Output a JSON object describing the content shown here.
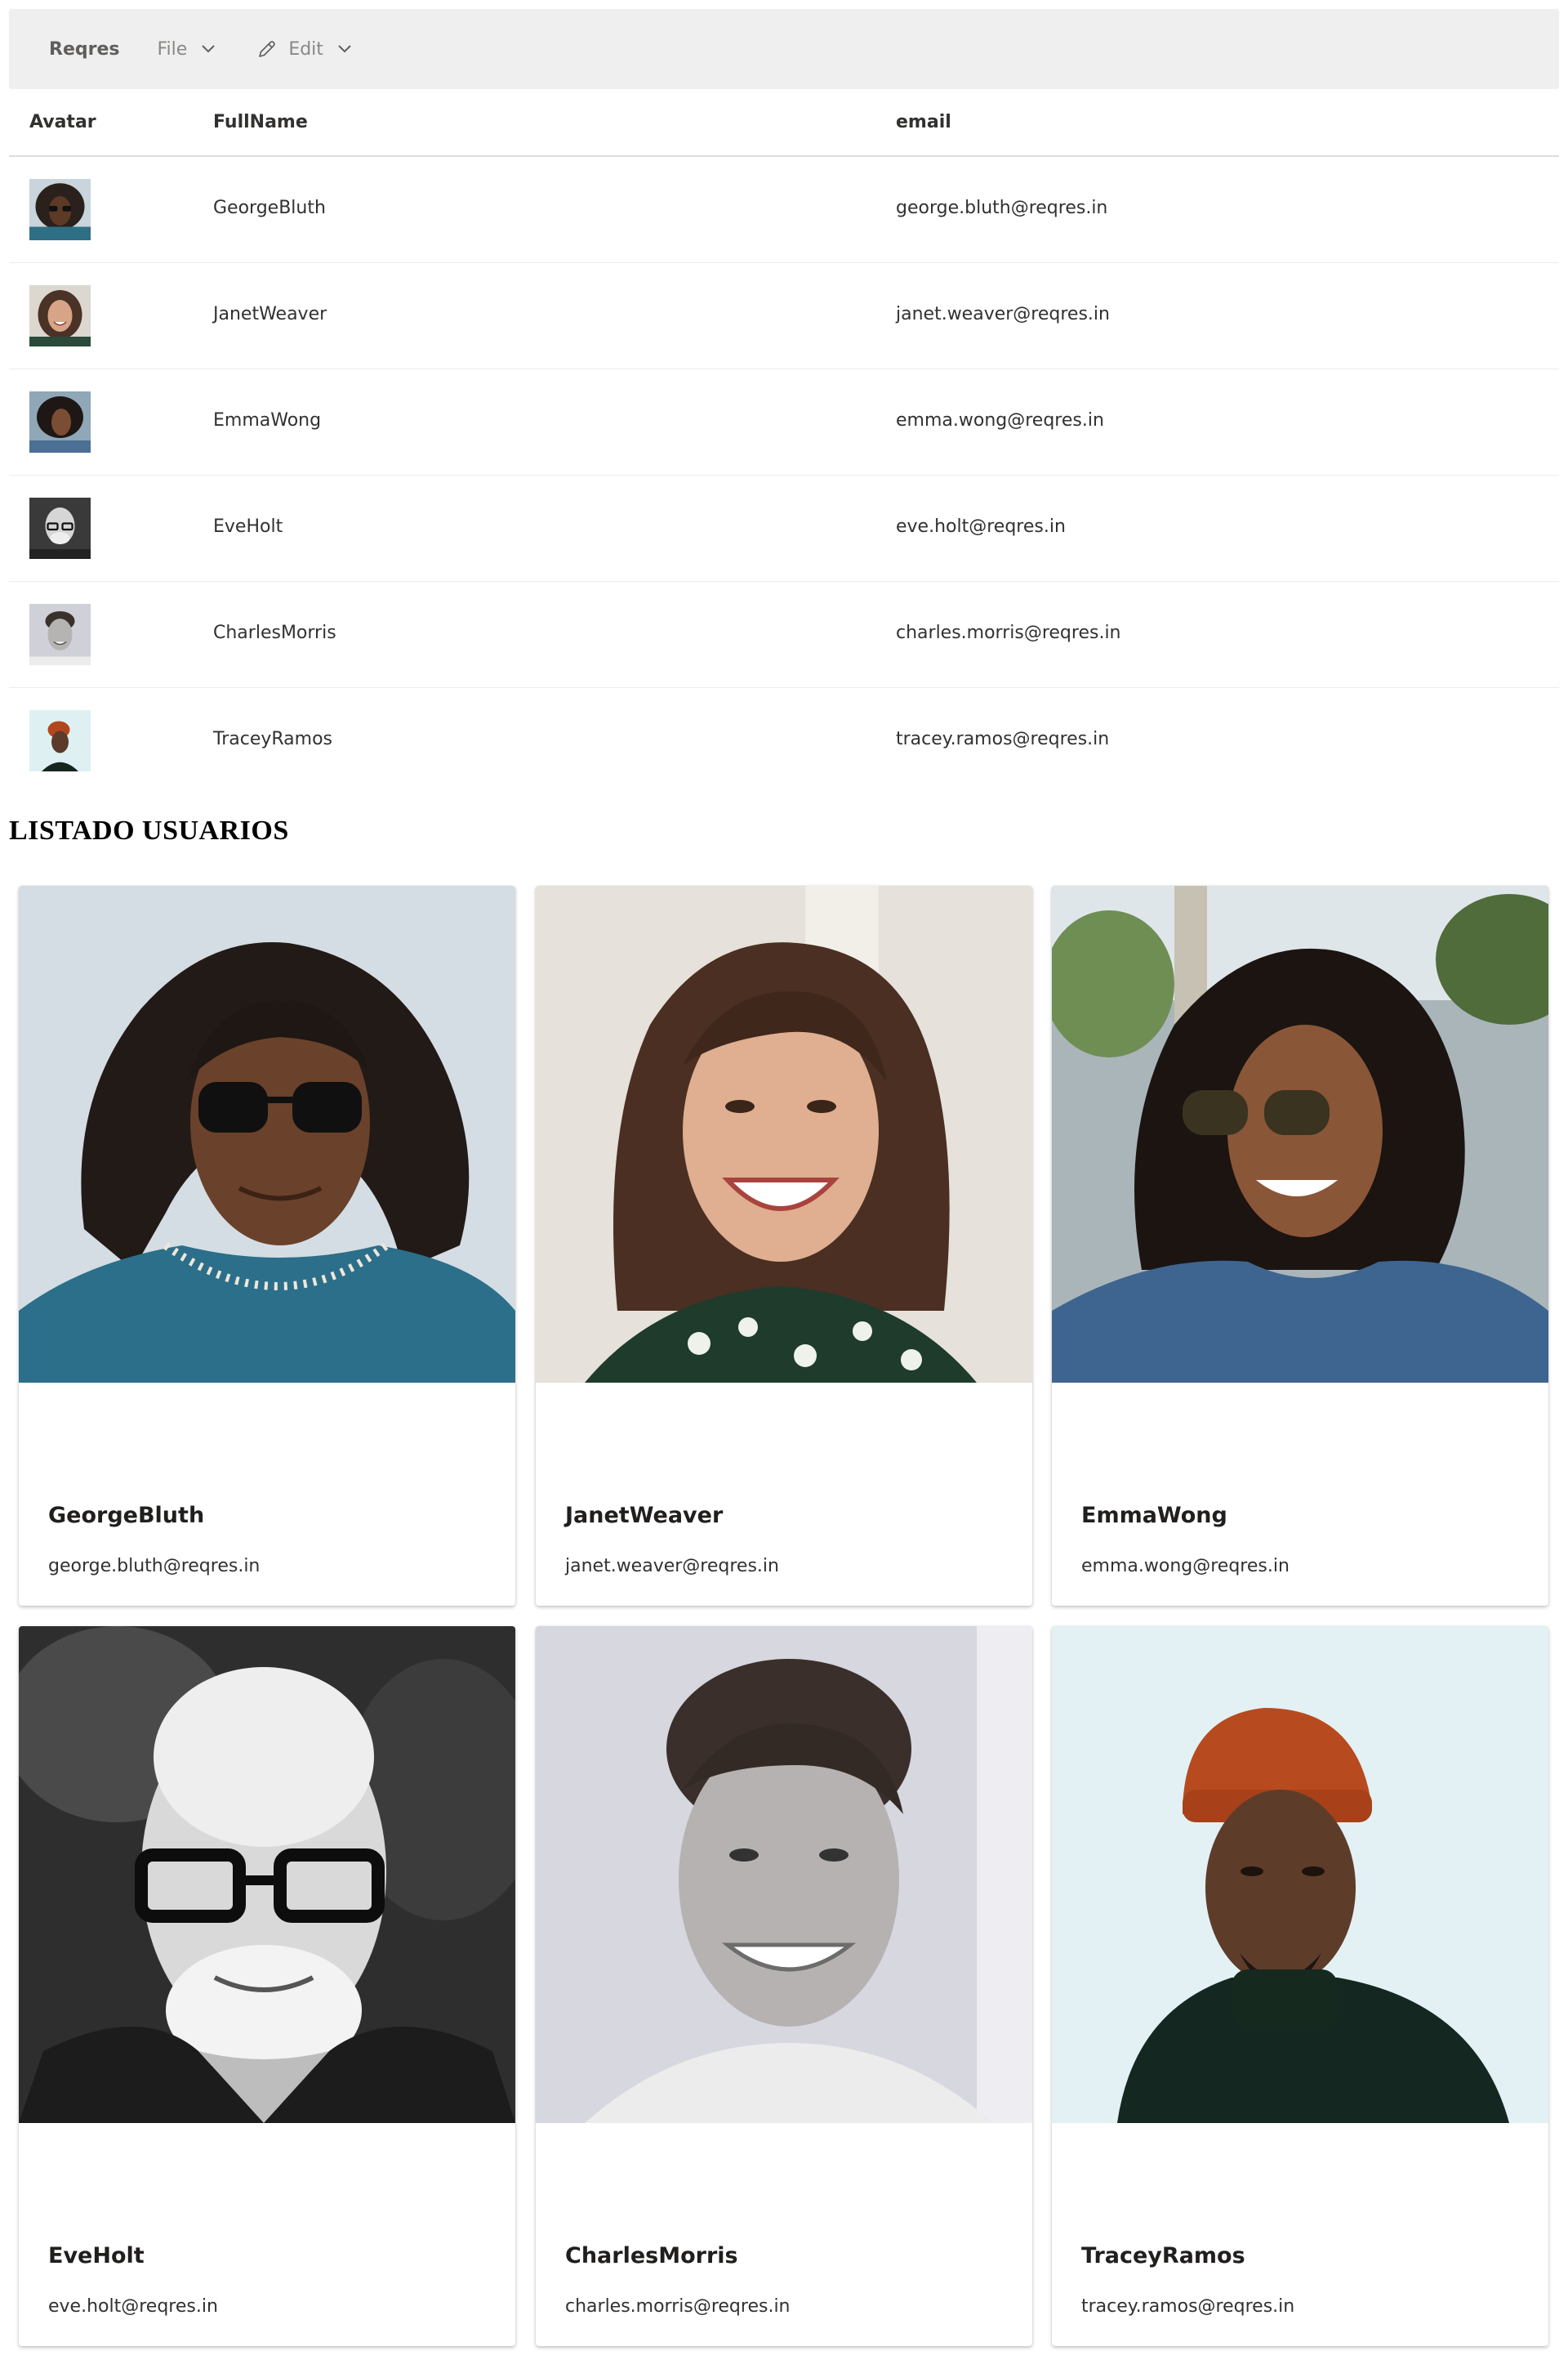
{
  "commandbar": {
    "brand": "Reqres",
    "menus": [
      {
        "label": "File",
        "icon": "chevron-down-icon"
      },
      {
        "label": "Edit",
        "icon": "pencil-icon"
      }
    ]
  },
  "table": {
    "headers": {
      "avatar": "Avatar",
      "fullname": "FullName",
      "email": "email"
    },
    "rows": [
      {
        "name": "GeorgeBluth",
        "email": "george.bluth@reqres.in"
      },
      {
        "name": "JanetWeaver",
        "email": "janet.weaver@reqres.in"
      },
      {
        "name": "EmmaWong",
        "email": "emma.wong@reqres.in"
      },
      {
        "name": "EveHolt",
        "email": "eve.holt@reqres.in"
      },
      {
        "name": "CharlesMorris",
        "email": "charles.morris@reqres.in"
      },
      {
        "name": "TraceyRamos",
        "email": "tracey.ramos@reqres.in"
      }
    ]
  },
  "section_title": "LISTADO USUARIOS",
  "cards": [
    {
      "name": "GeorgeBluth",
      "email": "george.bluth@reqres.in"
    },
    {
      "name": "JanetWeaver",
      "email": "janet.weaver@reqres.in"
    },
    {
      "name": "EmmaWong",
      "email": "emma.wong@reqres.in"
    },
    {
      "name": "EveHolt",
      "email": "eve.holt@reqres.in"
    },
    {
      "name": "CharlesMorris",
      "email": "charles.morris@reqres.in"
    },
    {
      "name": "TraceyRamos",
      "email": "tracey.ramos@reqres.in"
    }
  ]
}
